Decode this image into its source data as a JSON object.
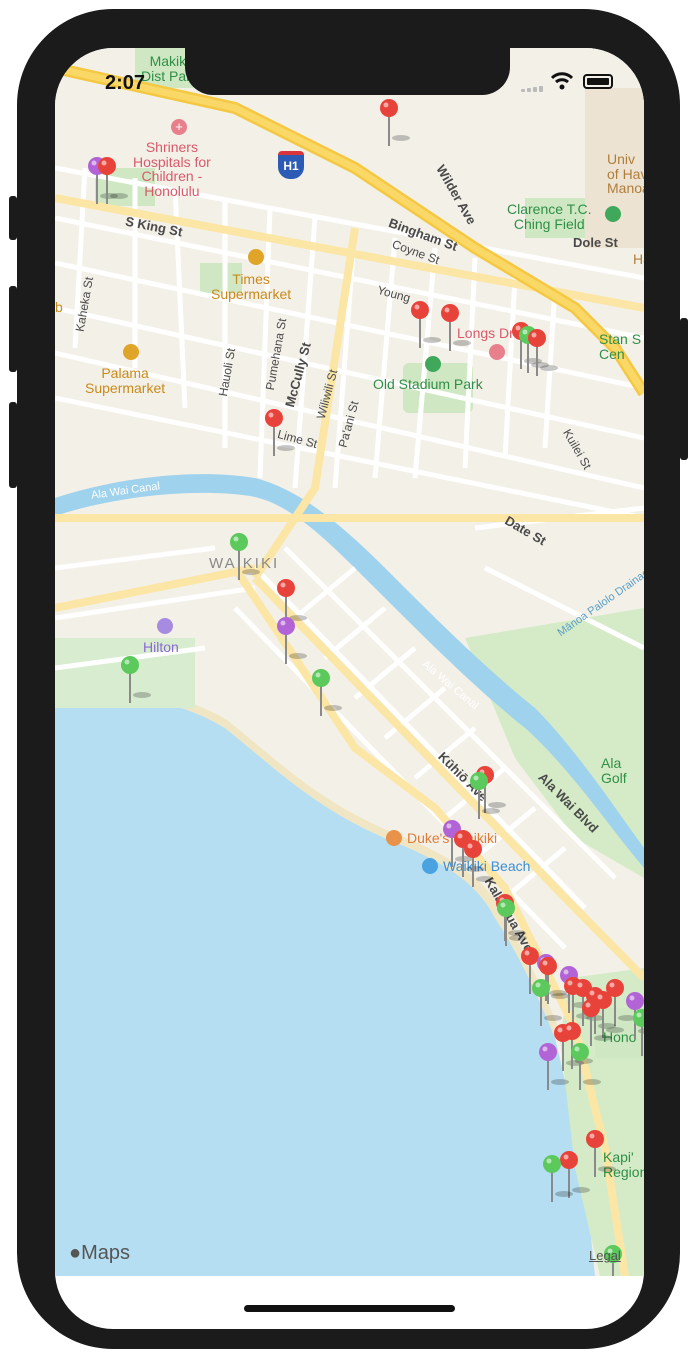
{
  "status_bar": {
    "time": "2:07"
  },
  "map": {
    "streets": {
      "s_king": "S King St",
      "bingham": "Bingham St",
      "wilder": "Wilder Ave",
      "coyne": "Coyne St",
      "young": "Young",
      "dole": "Dole St",
      "kaheka": "Kaheka St",
      "hauoli": "Hauoli St",
      "pumehana": "Pumehana St",
      "mccully": "McCully St",
      "wiliwili": "Wiliwili St",
      "paani": "Pa'ani St",
      "lime": "Lime St",
      "date": "Date St",
      "kuilei": "Kuilei St",
      "kuhio": "Kūhiō Ave",
      "kalakaua": "Kalakaua Ave",
      "ala_wai_blvd": "Ala Wai Blvd",
      "ala_wai_canal_1": "Ala Wai Canal",
      "ala_wai_canal_2": "Ala Wai Canal",
      "manoa_drainage": "Mānoa Palolo Drainage"
    },
    "places": {
      "makiki": "Makiki\nDist Park",
      "shriners": "Shriners\nHospitals for\nChildren -\nHonolulu",
      "times": "Times\nSupermarket",
      "palama": "Palama\nSupermarket",
      "old_stadium": "Old Stadium Park",
      "longs": "Longs Dr",
      "clarence": "Clarence T.C.\nChing Field",
      "univ": "Univ\nof Hav\nManoa",
      "stan_sheriff": "Stan S\nCen",
      "waikiki": "WAIKIKI",
      "hilton": "Hilton",
      "dukes": "Duke's Waikiki",
      "waikiki_beach": "Waikiki Beach",
      "ala_wai_golf": "Ala\nGolf",
      "honolulu_zoo": "Hono",
      "kapiolani": "Kapi'\nRegion",
      "edge_ha": "Ha",
      "edge_b": "b"
    },
    "highway_shield": "H1",
    "pin_colors": {
      "red": "#e8433a",
      "green": "#5bc95b",
      "purple": "#b264d6"
    },
    "pins": [
      {
        "color": "red"
      },
      {
        "color": "purple"
      },
      {
        "color": "red"
      },
      {
        "color": "red"
      },
      {
        "color": "red"
      },
      {
        "color": "red"
      },
      {
        "color": "green"
      },
      {
        "color": "red"
      },
      {
        "color": "red"
      },
      {
        "color": "green"
      },
      {
        "color": "red"
      },
      {
        "color": "purple"
      },
      {
        "color": "green"
      },
      {
        "color": "green"
      },
      {
        "color": "red"
      },
      {
        "color": "green"
      },
      {
        "color": "purple"
      },
      {
        "color": "red"
      },
      {
        "color": "red"
      },
      {
        "color": "red"
      },
      {
        "color": "green"
      },
      {
        "color": "red"
      },
      {
        "color": "purple"
      },
      {
        "color": "red"
      },
      {
        "color": "purple"
      },
      {
        "color": "green"
      },
      {
        "color": "red"
      },
      {
        "color": "red"
      },
      {
        "color": "red"
      },
      {
        "color": "red"
      },
      {
        "color": "red"
      },
      {
        "color": "purple"
      },
      {
        "color": "red"
      },
      {
        "color": "red"
      },
      {
        "color": "red"
      },
      {
        "color": "purple"
      },
      {
        "color": "green"
      },
      {
        "color": "green"
      },
      {
        "color": "red"
      },
      {
        "color": "red"
      },
      {
        "color": "green"
      },
      {
        "color": "green"
      }
    ]
  },
  "attribution": {
    "maps_logo": "Maps",
    "legal": "Legal"
  }
}
